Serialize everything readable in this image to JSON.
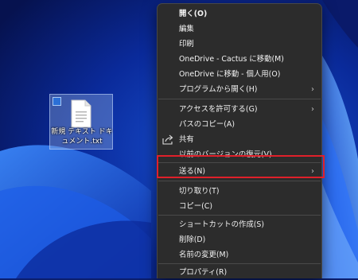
{
  "desktop": {
    "file_icon": {
      "name": "新規 テキスト ドキュメント.txt",
      "selected": true
    }
  },
  "context_menu": {
    "items": [
      {
        "label": "開く(O)",
        "bold": true
      },
      {
        "label": "編集"
      },
      {
        "label": "印刷"
      },
      {
        "label": "OneDrive - Cactus に移動(M)"
      },
      {
        "label": "OneDrive に移動 - 個人用(O)"
      },
      {
        "label": "プログラムから開く(H)",
        "submenu": true
      },
      {
        "label": "アクセスを許可する(G)",
        "submenu": true
      },
      {
        "label": "パスのコピー(A)"
      },
      {
        "label": "共有",
        "icon": "share-icon"
      },
      {
        "label": "以前のバージョンの復元(V)"
      },
      {
        "label": "送る(N)",
        "submenu": true,
        "highlighted": true
      },
      {
        "label": "切り取り(T)"
      },
      {
        "label": "コピー(C)"
      },
      {
        "label": "ショートカットの作成(S)"
      },
      {
        "label": "削除(D)"
      },
      {
        "label": "名前の変更(M)"
      },
      {
        "label": "プロパティ(R)"
      }
    ]
  },
  "colors": {
    "menu_bg": "#2c2c2c",
    "menu_text": "#f2f2f2",
    "highlight_border": "#e0202a",
    "wallpaper": "#0b1e6e"
  }
}
